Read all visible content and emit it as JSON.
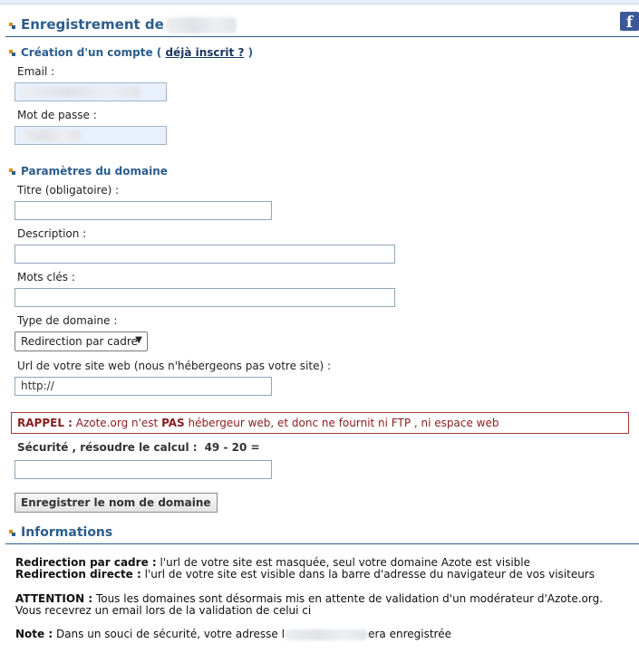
{
  "header": {
    "title": "Enregistrement de"
  },
  "account": {
    "section_title": "Création d'un compte (",
    "already_link": "déjà inscrit ?",
    "section_close": ")",
    "email_label": "Email :",
    "password_label": "Mot de passe :"
  },
  "domain": {
    "section_title": "Paramètres du domaine",
    "title_label": "Titre (obligatoire) :",
    "title_value": "",
    "description_label": "Description :",
    "description_value": "",
    "keywords_label": "Mots clés :",
    "keywords_value": "",
    "type_label": "Type de domaine :",
    "type_selected": "Redirection par cadre",
    "url_label": "Url de votre site web (nous n'hébergeons pas votre site) :",
    "url_value": "http://"
  },
  "notice": {
    "label": "RAPPEL :",
    "text_before": " Azote.org n'est ",
    "emphasis": "PAS",
    "text_after": " hébergeur web, et donc ne fournit ni FTP , ni espace web"
  },
  "security": {
    "label": "Sécurité , résoudre le calcul :",
    "calculation": "49 - 20 =",
    "answer_value": ""
  },
  "submit": {
    "label": "Enregistrer le nom de domaine"
  },
  "info": {
    "title": "Informations",
    "frame_label": "Redirection par cadre :",
    "frame_text": " l'url de votre site est masquée, seul votre domaine Azote est visible",
    "direct_label": "Redirection directe :",
    "direct_text": " l'url de votre site est visible dans la barre d'adresse du navigateur de vos visiteurs",
    "attention_label": "ATTENTION :",
    "attention_text": " Tous les domaines sont désormais mis en attente de validation d'un modérateur d'Azote.org. Vous recevrez un email lors de la validation de celui ci",
    "note_label": "Note :",
    "note_text_before": " Dans un souci de sécurité, votre adresse I",
    "note_text_after": "era enregistrée"
  },
  "social": {
    "facebook_glyph": "f"
  },
  "colors": {
    "heading": "#2c5d8e",
    "link": "#17365d",
    "notice_border": "#a33a3a",
    "notice_text": "#8a1d1d",
    "autofill_bg": "#e8f0fe",
    "facebook": "#3b5998"
  },
  "icons": {
    "section_bullet": "orange-blue-square-bullet-icon",
    "social": "facebook-icon",
    "dropdown": "chevron-down-icon"
  }
}
